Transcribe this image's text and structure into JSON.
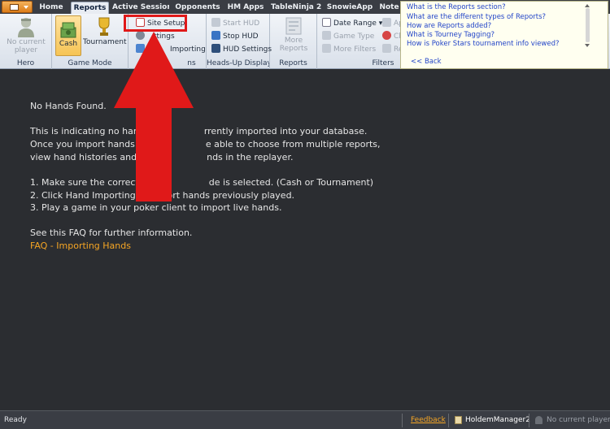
{
  "tabs": [
    {
      "label": "Home"
    },
    {
      "label": "Reports"
    },
    {
      "label": "Active Session"
    },
    {
      "label": "Opponents"
    },
    {
      "label": "HM Apps"
    },
    {
      "label": "TableNinja 2"
    },
    {
      "label": "SnowieApp"
    },
    {
      "label": "Note"
    }
  ],
  "ribbon": {
    "hero": {
      "label": "Hero",
      "no_player": "No current\nplayer"
    },
    "game_mode": {
      "label": "Game Mode",
      "cash": "Cash",
      "tournament": "Tournament"
    },
    "site": {
      "site_setup": "Site Setup",
      "settings": "ttings",
      "importing": "Importing",
      "label": "ns"
    },
    "hud": {
      "label": "Heads-Up Display",
      "start": "Start HUD",
      "stop": "Stop HUD",
      "settings": "HUD Settings"
    },
    "reports": {
      "label": "Reports",
      "more": "More\nReports"
    },
    "filters": {
      "label": "Filters",
      "date_range": "Date Range",
      "game_type": "Game Type",
      "more_filters": "More Filters",
      "ap": "Ap",
      "cl": "Cl",
      "re": "Re"
    }
  },
  "help": {
    "links": [
      "What is the Reports section?",
      "What are the different types of Reports?",
      "How are Reports added?",
      "What is Tourney Tagging?",
      "How is Poker Stars tournament info viewed?"
    ],
    "back": "<< Back"
  },
  "main": {
    "title": "No Hands Found.",
    "para1_line1": "This is indicating no hand",
    "para1_line1b": "rrently imported into your database.",
    "para1_line2": "Once you import hands y",
    "para1_line2b": "e able to choose from multiple reports,",
    "para1_line3": "view hand histories and r",
    "para1_line3b": "nds in the replayer.",
    "step1": "1. Make sure the correct",
    "step1b": "de is selected. (Cash or Tournament)",
    "step2": "2. Click Hand Importing to import hands previously played.",
    "step3": "3. Play a game in your poker client to import live hands.",
    "faq_intro": "See this FAQ for further information.",
    "faq_link": "FAQ - Importing Hands"
  },
  "status": {
    "ready": "Ready",
    "feedback": "Feedback",
    "app": "HoldemManager2",
    "player": "No current player"
  },
  "colors": {
    "accent_orange": "#f5a524",
    "annotation_red": "#e01919",
    "background": "#2b2d31"
  }
}
